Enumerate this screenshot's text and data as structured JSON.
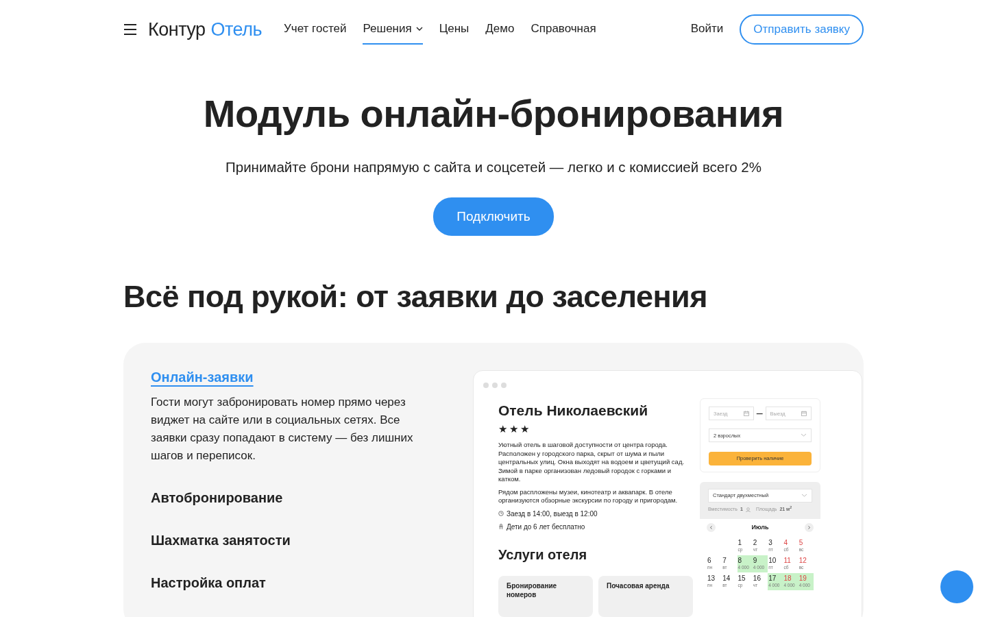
{
  "nav": {
    "brand_dark": "Контур",
    "brand_accent": "Отель",
    "links": [
      {
        "label": "Учет гостей",
        "selected": false,
        "dropdown": false
      },
      {
        "label": "Решения",
        "selected": true,
        "dropdown": true
      },
      {
        "label": "Цены",
        "selected": false,
        "dropdown": false
      },
      {
        "label": "Демо",
        "selected": false,
        "dropdown": false
      },
      {
        "label": "Справочная",
        "selected": false,
        "dropdown": false
      }
    ],
    "login": "Войти",
    "cta": "Отправить заявку"
  },
  "hero": {
    "title": "Модуль онлайн-бронирования",
    "subtitle": "Принимайте брони напрямую с сайта и соцсетей — легко и с комиссией всего 2%",
    "button": "Подключить"
  },
  "section": {
    "title": "Всё под рукой: от заявки до заселения",
    "features": [
      {
        "title": "Онлайн-заявки",
        "selected": true,
        "text": "Гости могут забронировать номер прямо через виджет на сайте или в социальных сетях. Все заявки сразу попадают в систему — без лишних шагов и переписок."
      },
      {
        "title": "Автобронирование",
        "selected": false
      },
      {
        "title": "Шахматка занятости",
        "selected": false
      },
      {
        "title": "Настройка оплат",
        "selected": false
      }
    ]
  },
  "mockup": {
    "hotel_name": "Отель Николаевский",
    "stars": 3,
    "description": [
      "Уютный отель в шаговой доступности от центра города. Расположен у городского парка, скрыт от шума и пыли центральных улиц. Окна выходят на водоем и цветущий сад. Зимой в парке организован ледовый городок с горками и катком.",
      "Рядом распложены музеи, кинотеатр и аквапарк. В отеле организуются обзорные экскурсии по городу и пригородам."
    ],
    "checkin": "Заезд в 14:00, выезд в 12:00",
    "children": "Дети до 6 лет бесплатно",
    "services_title": "Услуги отеля",
    "services": [
      "Бронирование номеров",
      "Почасовая аренда"
    ],
    "booking": {
      "checkin_placeholder": "Заезд",
      "checkout_placeholder": "Выезд",
      "dash": "–",
      "guests": "2 взрослых",
      "button": "Проверить наличие"
    },
    "room": {
      "name": "Стандарт двухместный",
      "capacity_label": "Вместимость",
      "capacity": "1",
      "area_label": "Площадь",
      "area": "21 м$^{2}$"
    },
    "calendar": {
      "month": "Июль",
      "weeks": [
        [
          {
            "day": "1",
            "weekday": "ср",
            "weekend": false,
            "available": false
          },
          {
            "day": "2",
            "weekday": "чт",
            "weekend": false,
            "available": false
          },
          {
            "day": "3",
            "weekday": "пт",
            "weekend": false,
            "available": false
          },
          {
            "day": "4",
            "weekday": "сб",
            "weekend": true,
            "available": false
          },
          {
            "day": "5",
            "weekday": "вс",
            "weekend": true,
            "available": false
          }
        ],
        [
          {
            "day": "6",
            "weekday": "пн",
            "weekend": false,
            "available": false
          },
          {
            "day": "7",
            "weekday": "вт",
            "weekend": false,
            "available": false
          },
          {
            "day": "8",
            "price": "4 000",
            "weekend": false,
            "available": true
          },
          {
            "day": "9",
            "price": "4 000",
            "weekend": false,
            "available": true
          },
          {
            "day": "10",
            "weekday": "пт",
            "weekend": false,
            "available": false
          },
          {
            "day": "11",
            "weekday": "сб",
            "weekend": true,
            "available": false
          },
          {
            "day": "12",
            "weekday": "вс",
            "weekend": true,
            "available": false
          }
        ],
        [
          {
            "day": "13",
            "weekday": "пн",
            "weekend": false,
            "available": false
          },
          {
            "day": "14",
            "weekday": "вт",
            "weekend": false,
            "available": false
          },
          {
            "day": "15",
            "weekday": "ср",
            "weekend": false,
            "available": false
          },
          {
            "day": "16",
            "weekday": "чт",
            "weekend": false,
            "available": false
          },
          {
            "day": "17",
            "price": "4 000",
            "weekend": false,
            "available": true
          },
          {
            "day": "18",
            "price": "4 000",
            "weekend": true,
            "available": true
          },
          {
            "day": "19",
            "price": "4 000",
            "weekend": true,
            "available": true
          }
        ]
      ]
    }
  }
}
